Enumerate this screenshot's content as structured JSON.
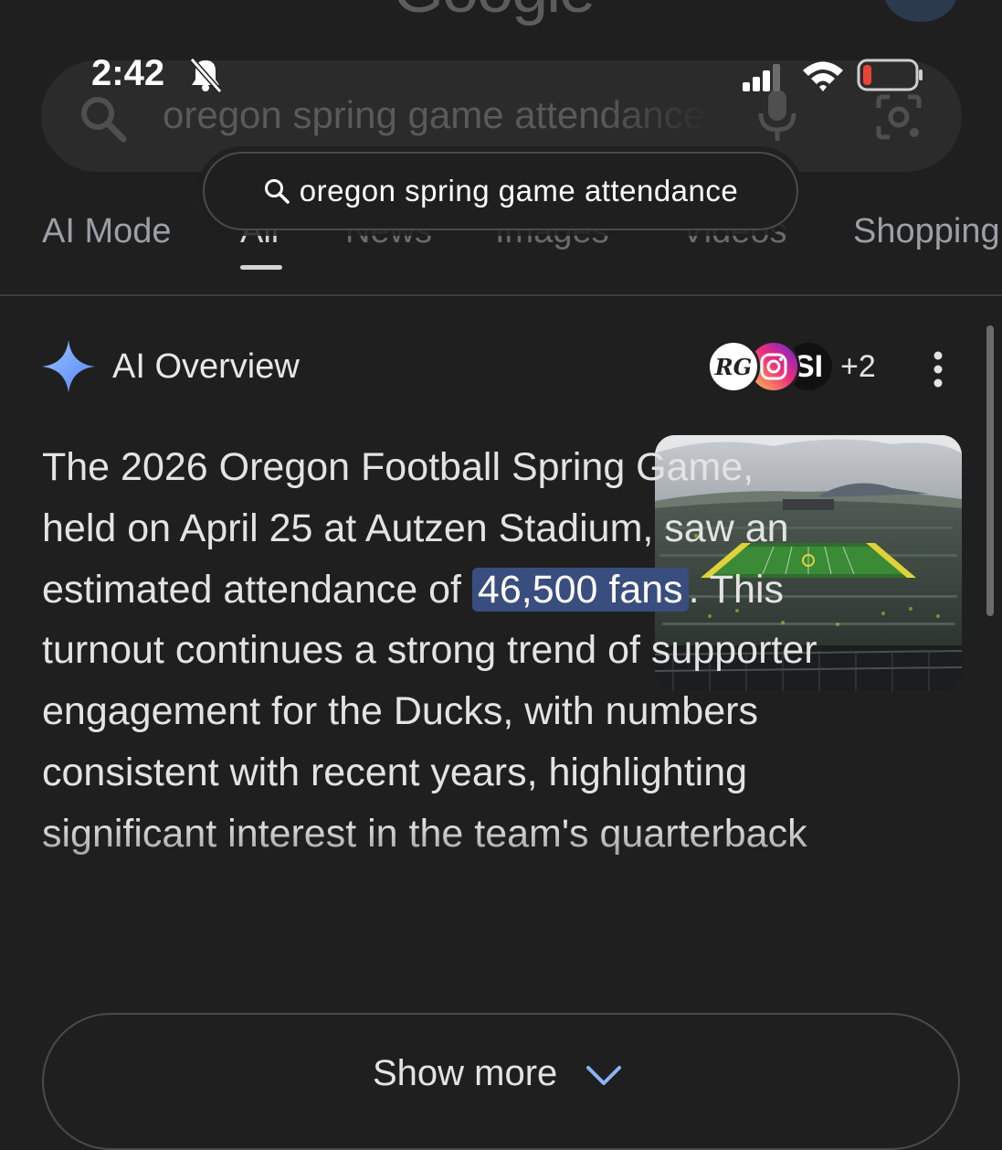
{
  "header": {
    "logo_text": "Google"
  },
  "status_bar": {
    "time": "2:42"
  },
  "search": {
    "query": "oregon spring game attendance",
    "pill_query": "oregon spring game attendance"
  },
  "tabs": [
    {
      "label": "AI Mode"
    },
    {
      "label": "All",
      "selected": true
    },
    {
      "label": "News"
    },
    {
      "label": "Images"
    },
    {
      "label": "Videos"
    },
    {
      "label": "Shopping"
    }
  ],
  "ai_overview": {
    "title": "AI Overview",
    "sources": [
      {
        "label": "RG"
      },
      {
        "label": "instagram-icon"
      },
      {
        "label": "SI"
      }
    ],
    "more_sources": "+2",
    "paragraph": {
      "before": "The 2026 Oregon Football Spring Game, held on April 25 at Autzen Stadium, saw an estimated attendance of ",
      "highlight": "46,500 fans",
      "after": ". This turnout continues a strong trend of supporter engagement for the Ducks, with numbers consistent with recent years, highlighting significant interest in the team's quarterback"
    },
    "show_more": "Show more"
  },
  "colors": {
    "background": "#1f1f1f",
    "highlight": "#394d7e",
    "sparkle": "#8ab4f8",
    "battery_low": "#ea4335"
  }
}
